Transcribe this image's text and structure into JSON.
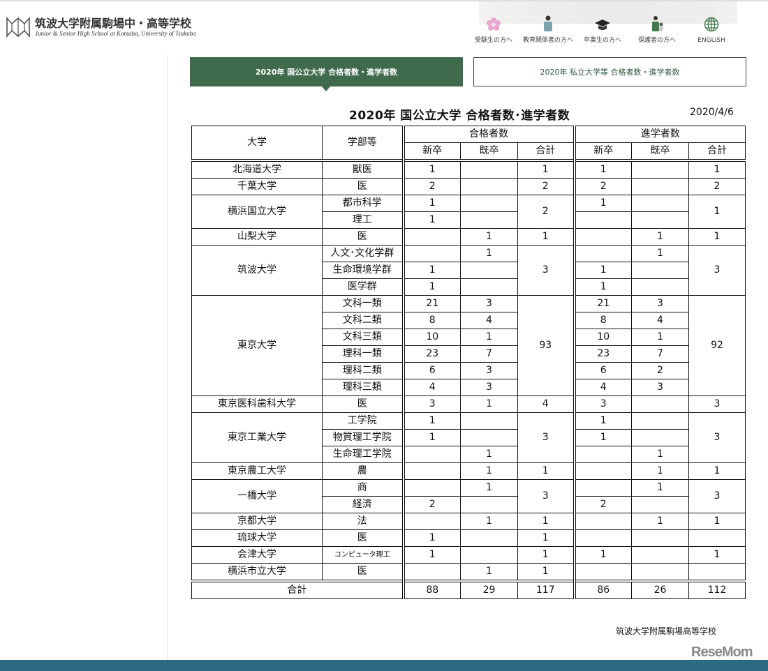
{
  "header": {
    "logo_jp": "筑波大学附属駒場中・高等学校",
    "logo_en": "Junior & Senior High School at Komaba, University of Tsukuba",
    "nav": [
      {
        "label": "受験生の方へ",
        "icon": "cherry-blossom-icon"
      },
      {
        "label": "教育関係者の方へ",
        "icon": "teacher-icon"
      },
      {
        "label": "卒業生の方へ",
        "icon": "graduation-cap-icon"
      },
      {
        "label": "保護者の方へ",
        "icon": "parent-child-icon"
      },
      {
        "label": "ENGLISH",
        "icon": "globe-icon"
      }
    ]
  },
  "tabs": [
    {
      "label": "2020年 国公立大学  合格者数・進学者数",
      "active": true
    },
    {
      "label": "2020年 私立大学等  合格者数・進学者数",
      "active": false
    }
  ],
  "table_title": "2020年  国公立大学  合格者数･進学者数",
  "date": "2020/4/6",
  "table": {
    "headers": {
      "university": "大学",
      "faculty": "学部等",
      "passed": "合格者数",
      "enrolled": "進学者数",
      "new": "新卒",
      "old": "既卒",
      "total": "合計"
    },
    "groups": [
      {
        "name": "北海道大学",
        "rows": [
          {
            "faculty": "獣医",
            "p_new": "1",
            "p_old": "",
            "e_new": "1",
            "e_old": ""
          }
        ],
        "p_total": "1",
        "e_total": "1"
      },
      {
        "name": "千葉大学",
        "rows": [
          {
            "faculty": "医",
            "p_new": "2",
            "p_old": "",
            "e_new": "2",
            "e_old": ""
          }
        ],
        "p_total": "2",
        "e_total": "2"
      },
      {
        "name": "横浜国立大学",
        "rows": [
          {
            "faculty": "都市科学",
            "p_new": "1",
            "p_old": "",
            "e_new": "1",
            "e_old": ""
          },
          {
            "faculty": "理工",
            "p_new": "1",
            "p_old": "",
            "e_new": "",
            "e_old": ""
          }
        ],
        "p_total": "2",
        "e_total": "1"
      },
      {
        "name": "山梨大学",
        "rows": [
          {
            "faculty": "医",
            "p_new": "",
            "p_old": "1",
            "e_new": "",
            "e_old": "1"
          }
        ],
        "p_total": "1",
        "e_total": "1"
      },
      {
        "name": "筑波大学",
        "rows": [
          {
            "faculty": "人文･文化学群",
            "p_new": "",
            "p_old": "1",
            "e_new": "",
            "e_old": "1"
          },
          {
            "faculty": "生命環境学群",
            "p_new": "1",
            "p_old": "",
            "e_new": "1",
            "e_old": ""
          },
          {
            "faculty": "医学群",
            "p_new": "1",
            "p_old": "",
            "e_new": "1",
            "e_old": ""
          }
        ],
        "p_total": "3",
        "e_total": "3"
      },
      {
        "name": "東京大学",
        "rows": [
          {
            "faculty": "文科一類",
            "p_new": "21",
            "p_old": "3",
            "e_new": "21",
            "e_old": "3"
          },
          {
            "faculty": "文科二類",
            "p_new": "8",
            "p_old": "4",
            "e_new": "8",
            "e_old": "4"
          },
          {
            "faculty": "文科三類",
            "p_new": "10",
            "p_old": "1",
            "e_new": "10",
            "e_old": "1"
          },
          {
            "faculty": "理科一類",
            "p_new": "23",
            "p_old": "7",
            "e_new": "23",
            "e_old": "7"
          },
          {
            "faculty": "理科二類",
            "p_new": "6",
            "p_old": "3",
            "e_new": "6",
            "e_old": "2"
          },
          {
            "faculty": "理科三類",
            "p_new": "4",
            "p_old": "3",
            "e_new": "4",
            "e_old": "3"
          }
        ],
        "p_total": "93",
        "e_total": "92"
      },
      {
        "name": "東京医科歯科大学",
        "rows": [
          {
            "faculty": "医",
            "p_new": "3",
            "p_old": "1",
            "e_new": "3",
            "e_old": ""
          }
        ],
        "p_total": "4",
        "e_total": "3"
      },
      {
        "name": "東京工業大学",
        "rows": [
          {
            "faculty": "工学院",
            "p_new": "1",
            "p_old": "",
            "e_new": "1",
            "e_old": ""
          },
          {
            "faculty": "物質理工学院",
            "p_new": "1",
            "p_old": "",
            "e_new": "1",
            "e_old": ""
          },
          {
            "faculty": "生命理工学院",
            "p_new": "",
            "p_old": "1",
            "e_new": "",
            "e_old": "1"
          }
        ],
        "p_total": "3",
        "e_total": "3"
      },
      {
        "name": "東京農工大学",
        "rows": [
          {
            "faculty": "農",
            "p_new": "",
            "p_old": "1",
            "e_new": "",
            "e_old": "1"
          }
        ],
        "p_total": "1",
        "e_total": "1"
      },
      {
        "name": "一橋大学",
        "rows": [
          {
            "faculty": "商",
            "p_new": "",
            "p_old": "1",
            "e_new": "",
            "e_old": "1"
          },
          {
            "faculty": "経済",
            "p_new": "2",
            "p_old": "",
            "e_new": "2",
            "e_old": ""
          }
        ],
        "p_total": "3",
        "e_total": "3"
      },
      {
        "name": "京都大学",
        "rows": [
          {
            "faculty": "法",
            "p_new": "",
            "p_old": "1",
            "e_new": "",
            "e_old": "1"
          }
        ],
        "p_total": "1",
        "e_total": "1"
      },
      {
        "name": "琉球大学",
        "rows": [
          {
            "faculty": "医",
            "p_new": "1",
            "p_old": "",
            "e_new": "",
            "e_old": ""
          }
        ],
        "p_total": "1",
        "e_total": ""
      },
      {
        "name": "会津大学",
        "rows": [
          {
            "faculty": "コンピュータ理工",
            "p_new": "1",
            "p_old": "",
            "e_new": "1",
            "e_old": ""
          }
        ],
        "p_total": "1",
        "e_total": "1"
      },
      {
        "name": "横浜市立大学",
        "rows": [
          {
            "faculty": "医",
            "p_new": "",
            "p_old": "1",
            "e_new": "",
            "e_old": ""
          }
        ],
        "p_total": "1",
        "e_total": ""
      }
    ],
    "total": {
      "label": "合計",
      "p_new": "88",
      "p_old": "29",
      "p_total": "117",
      "e_new": "86",
      "e_old": "26",
      "e_total": "112"
    }
  },
  "source": "筑波大学附属駒場高等学校",
  "watermark": "ReseMom",
  "colors": {
    "accent": "#3f6a4c",
    "bottom_bar": "#2c6a82"
  }
}
